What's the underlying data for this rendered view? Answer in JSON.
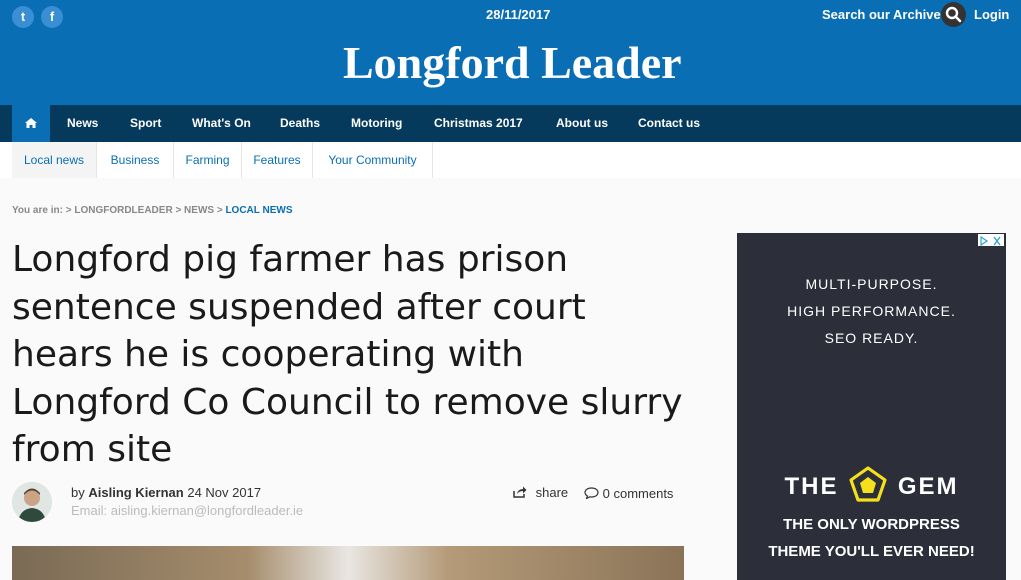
{
  "top": {
    "date": "28/11/2017",
    "search_label": "Search our Archive",
    "login": "Login",
    "logo": "Longford Leader",
    "social": [
      {
        "name": "twitter-icon",
        "glyph": "t"
      },
      {
        "name": "facebook-icon",
        "glyph": "f"
      }
    ]
  },
  "nav": {
    "home_icon": "home-icon",
    "items": [
      "News",
      "Sport",
      "What's On",
      "Deaths",
      "Motoring",
      "Christmas 2017",
      "About us",
      "Contact us"
    ]
  },
  "subnav": {
    "items": [
      "Local news",
      "Business",
      "Farming",
      "Features",
      "Your Community"
    ]
  },
  "breadcrumb": {
    "prefix": "You are in: > LONGFORDLEADER > NEWS > ",
    "current": "LOCAL NEWS"
  },
  "article": {
    "headline": "Longford pig farmer has prison sentence suspended after court hears he is cooperating with Longford Co Council to remove slurry from site",
    "by": "by",
    "author": "Aisling Kiernan",
    "date": "24 Nov 2017",
    "email": "Email: aisling.kiernan@longfordleader.ie",
    "share": "share",
    "comments": "0 comments"
  },
  "ad": {
    "line1": "MULTI-PURPOSE.",
    "line2": "HIGH PERFORMANCE.",
    "line3": "SEO READY.",
    "brand_left": "THE",
    "brand_right": "GEM",
    "tagline1": "THE ONLY WORDPRESS",
    "tagline2": "THEME YOU'LL EVER NEED!"
  },
  "colors": {
    "brand_blue": "#0a6eb4",
    "nav_dark": "#063a5c",
    "ad_bg": "#2c2f3a",
    "gem_yellow": "#f4e01b"
  }
}
